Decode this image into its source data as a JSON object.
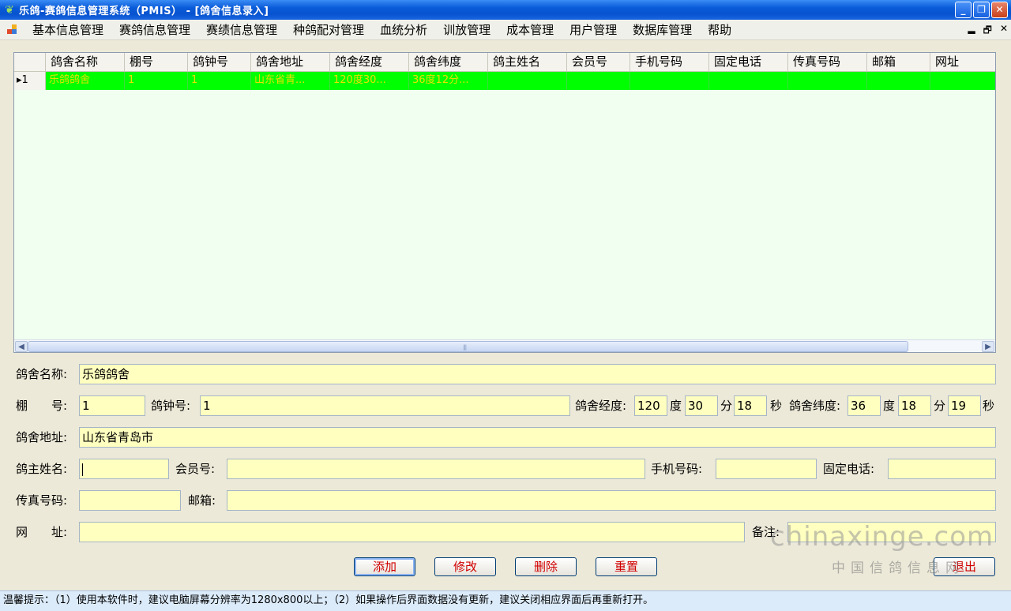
{
  "window": {
    "title": "乐鸽-赛鸽信息管理系统（PMIS） - [鸽舍信息录入]",
    "minimize": "_",
    "restore": "❐",
    "close": "✕"
  },
  "menu": {
    "items": [
      "基本信息管理",
      "赛鸽信息管理",
      "赛绩信息管理",
      "种鸽配对管理",
      "血统分析",
      "训放管理",
      "成本管理",
      "用户管理",
      "数据库管理",
      "帮助"
    ],
    "mdi_minimize": "▂",
    "mdi_restore": "🗗",
    "mdi_close": "✕"
  },
  "grid": {
    "columns": [
      "鸽舍名称",
      "棚号",
      "鸽钟号",
      "鸽舍地址",
      "鸽舍经度",
      "鸽舍纬度",
      "鸽主姓名",
      "会员号",
      "手机号码",
      "固定电话",
      "传真号码",
      "邮箱",
      "网址"
    ],
    "rows": [
      {
        "indicator": "▸1",
        "cells": [
          "乐鸽鸽舍",
          "1",
          "1",
          "山东省青...",
          "120度30...",
          "36度12分...",
          "",
          "",
          "",
          "",
          "",
          "",
          ""
        ]
      }
    ],
    "scroll_left": "◀",
    "scroll_right": "▶",
    "scroll_grip": "|||"
  },
  "form": {
    "name_label": "鸽舍名称:",
    "name_value": "乐鸽鸽舍",
    "loft_label": "棚　　号:",
    "loft_value": "1",
    "clock_label": "鸽钟号:",
    "clock_value": "1",
    "longitude_label": "鸽舍经度:",
    "lon_deg": "120",
    "lon_min": "30",
    "lon_sec": "18",
    "latitude_label": "鸽舍纬度:",
    "lat_deg": "36",
    "lat_min": "18",
    "lat_sec": "19",
    "deg_unit": "度",
    "min_unit": "分",
    "sec_unit": "秒",
    "address_label": "鸽舍地址:",
    "address_value": "山东省青岛市",
    "owner_label": "鸽主姓名:",
    "owner_value": "",
    "member_label": "会员号:",
    "member_value": "",
    "mobile_label": "手机号码:",
    "mobile_value": "",
    "phone_label": "固定电话:",
    "phone_value": "",
    "fax_label": "传真号码:",
    "fax_value": "",
    "email_label": "邮箱:",
    "email_value": "",
    "website_label": "网　　址:",
    "website_value": "",
    "remark_label": "备注:",
    "remark_value": ""
  },
  "buttons": {
    "add": "添加",
    "edit": "修改",
    "delete": "删除",
    "reset": "重置",
    "exit": "退出"
  },
  "watermark": {
    "domain": "chinaxinge.com",
    "name": "中国信鸽信息网"
  },
  "status": {
    "text": "温馨提示：（1）使用本软件时，建议电脑屏幕分辨率为1280x800以上；（2）如果操作后界面数据没有更新，建议关闭相应界面后再重新打开。"
  },
  "colors": {
    "selected_row": "#00ff00",
    "field_bg": "#ffffc0",
    "button_text": "#d00000",
    "grid_bg": "#f0fff0"
  }
}
